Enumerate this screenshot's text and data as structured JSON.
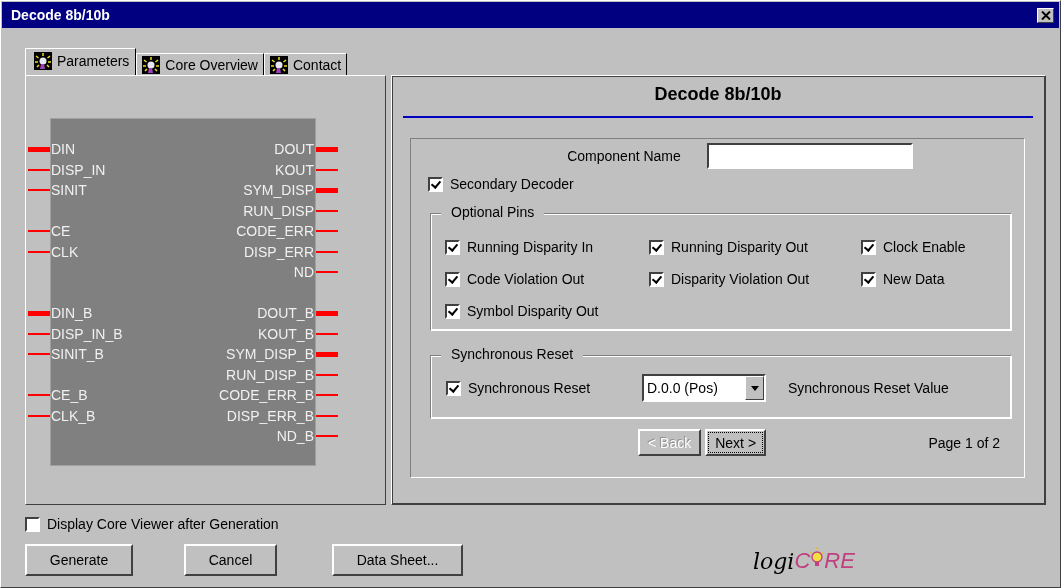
{
  "window": {
    "title": "Decode 8b/10b"
  },
  "tabs": [
    {
      "label": "Parameters",
      "selected": true
    },
    {
      "label": "Core Overview",
      "selected": false
    },
    {
      "label": "Contact",
      "selected": false
    }
  ],
  "symbol": {
    "rows": [
      {
        "left": {
          "name": "DIN",
          "bus": true
        },
        "right": {
          "name": "DOUT",
          "bus": true
        }
      },
      {
        "left": {
          "name": "DISP_IN",
          "bus": false
        },
        "right": {
          "name": "KOUT",
          "bus": false
        }
      },
      {
        "left": {
          "name": "SINIT",
          "bus": false
        },
        "right": {
          "name": "SYM_DISP",
          "bus": true
        }
      },
      {
        "left": null,
        "right": {
          "name": "RUN_DISP",
          "bus": false
        }
      },
      {
        "left": {
          "name": "CE",
          "bus": false
        },
        "right": {
          "name": "CODE_ERR",
          "bus": false
        }
      },
      {
        "left": {
          "name": "CLK",
          "bus": false
        },
        "right": {
          "name": "DISP_ERR",
          "bus": false
        }
      },
      {
        "left": null,
        "right": {
          "name": "ND",
          "bus": false
        }
      },
      {
        "left": null,
        "right": null
      },
      {
        "left": {
          "name": "DIN_B",
          "bus": true
        },
        "right": {
          "name": "DOUT_B",
          "bus": true
        }
      },
      {
        "left": {
          "name": "DISP_IN_B",
          "bus": false
        },
        "right": {
          "name": "KOUT_B",
          "bus": false
        }
      },
      {
        "left": {
          "name": "SINIT_B",
          "bus": false
        },
        "right": {
          "name": "SYM_DISP_B",
          "bus": true
        }
      },
      {
        "left": null,
        "right": {
          "name": "RUN_DISP_B",
          "bus": false
        }
      },
      {
        "left": {
          "name": "CE_B",
          "bus": false
        },
        "right": {
          "name": "CODE_ERR_B",
          "bus": false
        }
      },
      {
        "left": {
          "name": "CLK_B",
          "bus": false
        },
        "right": {
          "name": "DISP_ERR_B",
          "bus": false
        }
      },
      {
        "left": null,
        "right": {
          "name": "ND_B",
          "bus": false
        }
      }
    ]
  },
  "panel": {
    "heading": "Decode 8b/10b",
    "component_name": {
      "label": "Component Name"
    },
    "secondary_decoder": {
      "label": "Secondary Decoder",
      "checked": true
    },
    "optional_pins": {
      "title": "Optional Pins",
      "items": [
        {
          "label": "Running Disparity In",
          "checked": true
        },
        {
          "label": "Running Disparity Out",
          "checked": true
        },
        {
          "label": "Clock Enable",
          "checked": true
        },
        {
          "label": "Code Violation Out",
          "checked": true
        },
        {
          "label": "Disparity Violation Out",
          "checked": true
        },
        {
          "label": "New Data",
          "checked": true
        },
        {
          "label": "Symbol Disparity Out",
          "checked": true
        }
      ]
    },
    "sync_reset": {
      "title": "Synchronous Reset",
      "checkbox": {
        "label": "Synchronous Reset",
        "checked": true
      },
      "value": "D.0.0 (Pos)",
      "value_label": "Synchronous Reset Value"
    },
    "back": {
      "label": "< Back",
      "disabled": true
    },
    "next": {
      "label": "Next >",
      "disabled": false
    },
    "page": "Page 1 of 2"
  },
  "display_viewer": {
    "label": "Display Core Viewer after Generation",
    "checked": false
  },
  "buttons": [
    "Generate",
    "Cancel",
    "Data Sheet..."
  ],
  "logo": [
    "logi",
    "C",
    "RE"
  ]
}
